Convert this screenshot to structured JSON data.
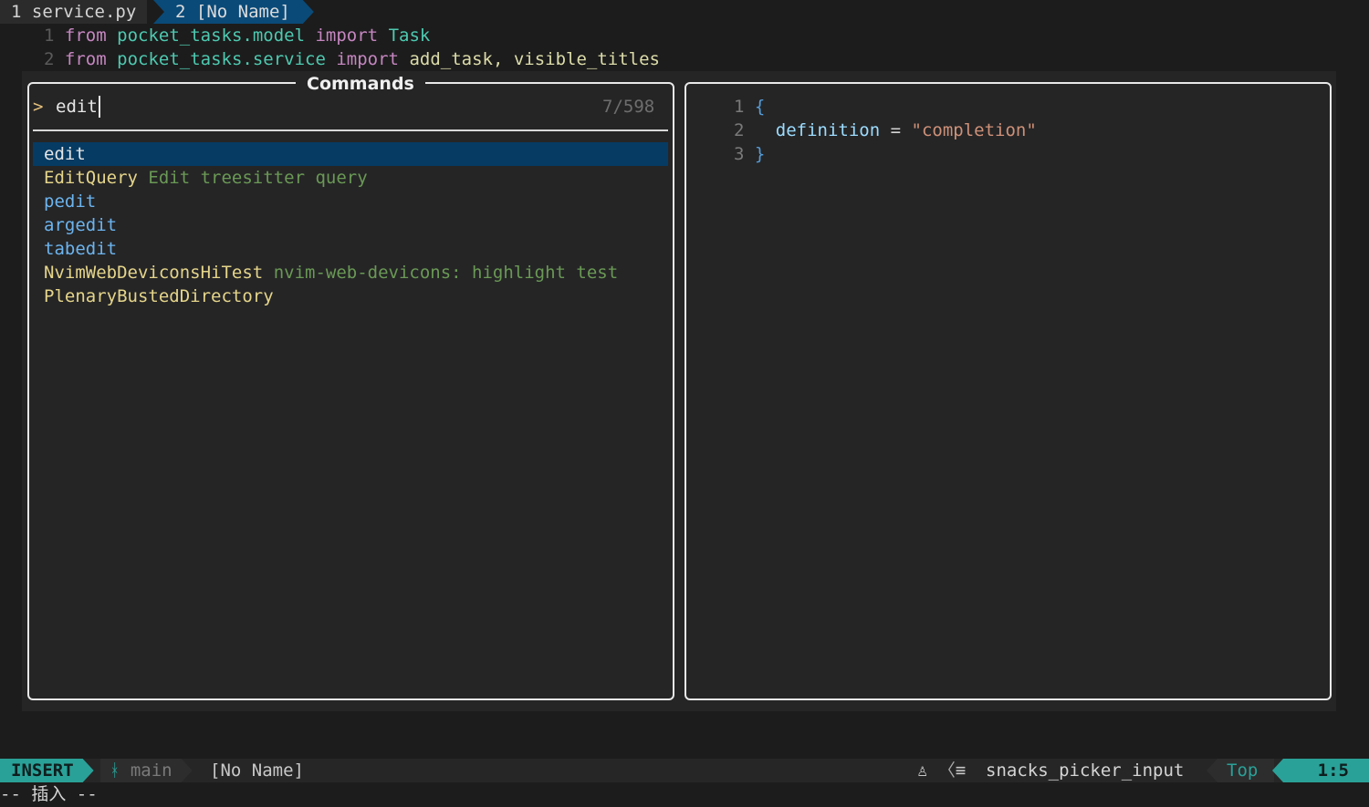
{
  "tabline": {
    "tabs": [
      {
        "label": "1 service.py"
      },
      {
        "label": "2 [No Name]"
      }
    ]
  },
  "buffer": {
    "lines": [
      {
        "number": "1",
        "kw1": "from",
        "module": "pocket_tasks.model",
        "kw2": "import",
        "names": "Task"
      },
      {
        "number": "2",
        "kw1": "from",
        "module": "pocket_tasks.service",
        "kw2": "import",
        "names": "add_task, visible_titles"
      }
    ]
  },
  "picker": {
    "title": "Commands",
    "prompt_symbol": ">",
    "query": "edit",
    "count": "7/598",
    "items": [
      {
        "pre": "",
        "match": "edit",
        "post": "",
        "desc": ""
      },
      {
        "pre": "",
        "match": "Edit",
        "post": "Query",
        "desc": "Edit treesitter query"
      },
      {
        "pre": "p",
        "match": "edit",
        "post": "",
        "desc": ""
      },
      {
        "pre": "arg",
        "match": "edit",
        "post": "",
        "desc": ""
      },
      {
        "pre": "tab",
        "match": "edit",
        "post": "",
        "desc": ""
      },
      {
        "pre": "NvimWebDeviconsHiT",
        "match": "est",
        "post": "",
        "desc": "nvim-web-devicons: highlight test"
      },
      {
        "pre": "PlenaryBust",
        "match": "edDi",
        "post": "rectory",
        "desc": ""
      }
    ]
  },
  "preview": {
    "lines": [
      {
        "number": "1",
        "text": "{"
      },
      {
        "number": "2",
        "key": "definition",
        "op": "=",
        "value": "\"completion\""
      },
      {
        "number": "3",
        "text": "}"
      }
    ]
  },
  "statusline": {
    "mode": "INSERT",
    "branch_icon": "git-branch-icon",
    "branch": "main",
    "filename": "[No Name]",
    "os_icon": "linux-icon",
    "filetype_icon": "lines-icon",
    "filetype": "snacks_picker_input",
    "position": "Top",
    "cursor": "1:5"
  },
  "cmdline": {
    "text": "-- 插入 --"
  }
}
